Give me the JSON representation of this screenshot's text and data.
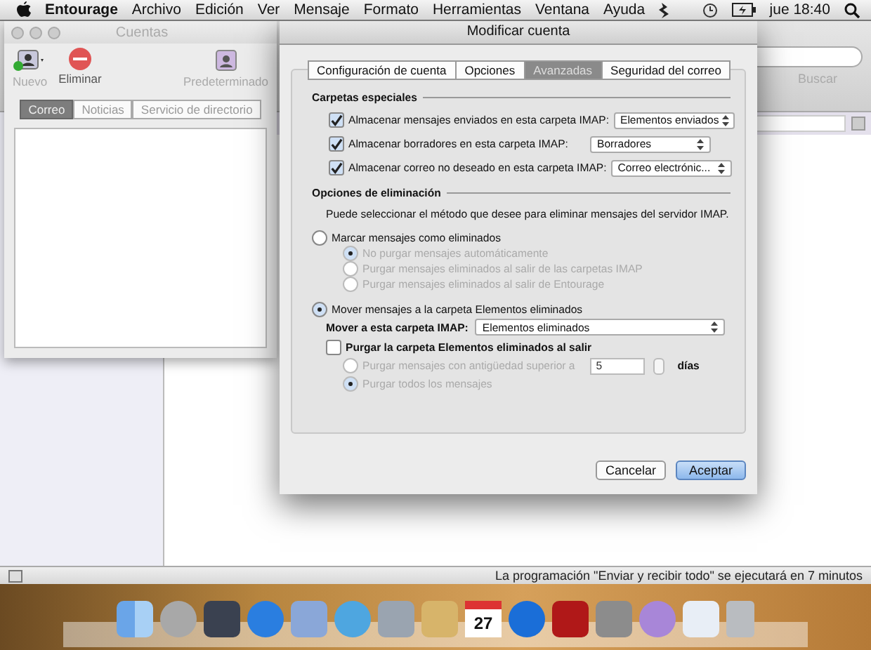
{
  "menubar": {
    "app": "Entourage",
    "items": [
      "Archivo",
      "Edición",
      "Ver",
      "Mensaje",
      "Formato",
      "Herramientas",
      "Ventana",
      "Ayuda"
    ],
    "clock": "jue 18:40"
  },
  "main_window": {
    "search_label": "Buscar",
    "status_bar": "La programación \"Enviar y recibir todo\" se ejecutará en 7 minutos"
  },
  "accounts_window": {
    "title": "Cuentas",
    "toolbar": [
      {
        "label": "Nuevo",
        "disabled": true
      },
      {
        "label": "Eliminar",
        "disabled": false
      },
      {
        "label": "Predeterminado",
        "disabled": true
      }
    ],
    "tabs": [
      {
        "label": "Correo",
        "selected": true
      },
      {
        "label": "Noticias",
        "selected": false
      },
      {
        "label": "Servicio de directorio",
        "selected": false
      }
    ]
  },
  "dialog": {
    "title": "Modificar cuenta",
    "tabs": [
      {
        "label": "Configuración de cuenta",
        "selected": false
      },
      {
        "label": "Opciones",
        "selected": false
      },
      {
        "label": "Avanzadas",
        "selected": true
      },
      {
        "label": "Seguridad del correo",
        "selected": false
      }
    ],
    "special_folders": {
      "title": "Carpetas especiales",
      "rows": [
        {
          "label": "Almacenar mensajes enviados en esta carpeta IMAP:",
          "checked": true,
          "value": "Elementos enviados"
        },
        {
          "label": "Almacenar borradores en esta carpeta IMAP:",
          "checked": true,
          "value": "Borradores"
        },
        {
          "label": "Almacenar correo no deseado en esta carpeta IMAP:",
          "checked": true,
          "value": "Correo electrónic..."
        }
      ]
    },
    "deletion": {
      "title": "Opciones de eliminación",
      "description": "Puede seleccionar el método que desee para eliminar mensajes del servidor IMAP.",
      "options": [
        {
          "label": "Marcar mensajes como eliminados",
          "selected": false,
          "disabled": false,
          "children": [
            {
              "label": "No purgar mensajes automáticamente",
              "selected": true,
              "disabled": true
            },
            {
              "label": "Purgar mensajes eliminados al salir de las carpetas IMAP",
              "selected": false,
              "disabled": true
            },
            {
              "label": "Purgar mensajes eliminados al salir de Entourage",
              "selected": false,
              "disabled": true
            }
          ]
        },
        {
          "label": "Mover mensajes a la carpeta Elementos eliminados",
          "selected": true,
          "disabled": false
        }
      ],
      "move_folder": {
        "label": "Mover a esta carpeta IMAP:",
        "value": "Elementos eliminados"
      },
      "purge": {
        "label": "Purgar la carpeta Elementos eliminados al salir",
        "checked": false,
        "options": [
          {
            "label": "Purgar mensajes con antigüedad superior a",
            "selected": false,
            "disabled": true,
            "days": "5",
            "unit": "días"
          },
          {
            "label": "Purgar todos los mensajes",
            "selected": true,
            "disabled": true
          }
        ]
      }
    },
    "buttons": [
      {
        "label": "Cancelar",
        "default": false
      },
      {
        "label": "Aceptar",
        "default": true
      }
    ]
  },
  "dock": {
    "calendar_day": "27"
  }
}
